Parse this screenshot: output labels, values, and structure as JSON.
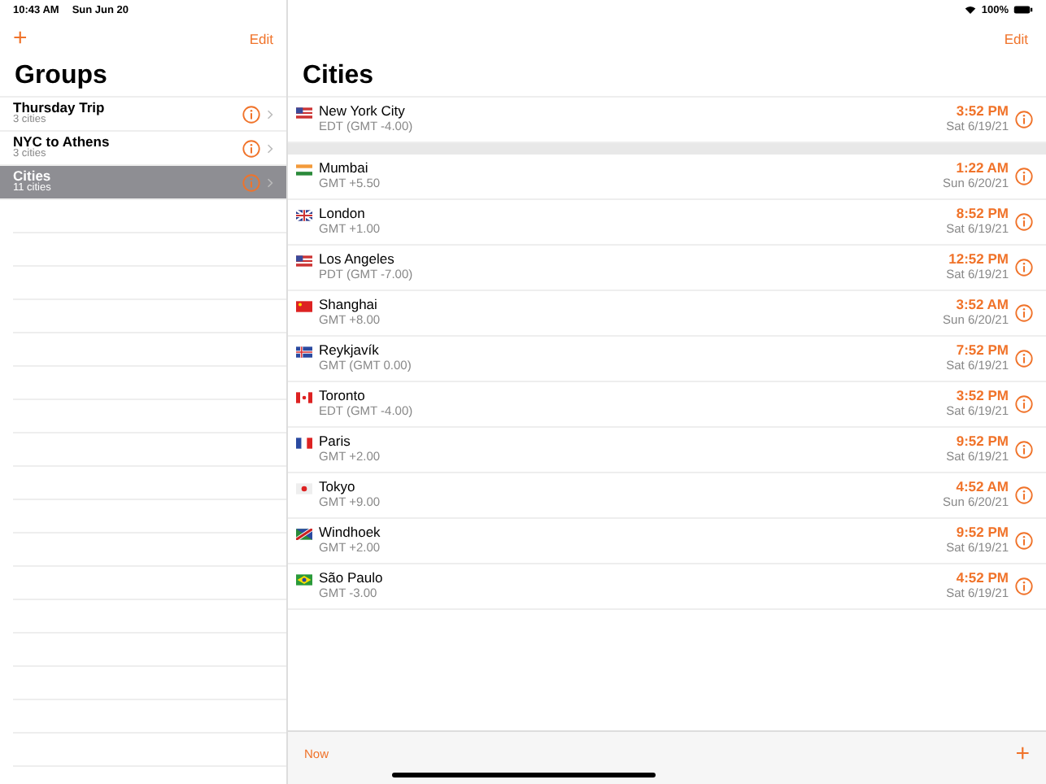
{
  "status_bar": {
    "time": "10:43 AM",
    "date": "Sun Jun 20",
    "battery": "100%"
  },
  "groups_pane": {
    "add": "+",
    "edit": "Edit",
    "title": "Groups",
    "items": [
      {
        "name": "Thursday Trip",
        "count": "3 cities",
        "selected": false
      },
      {
        "name": "NYC to Athens",
        "count": "3 cities",
        "selected": false
      },
      {
        "name": "Cities",
        "count": "11 cities",
        "selected": true
      }
    ]
  },
  "cities_pane": {
    "edit": "Edit",
    "title": "Cities",
    "home": {
      "kind": "us",
      "name": "New York City",
      "zone": "EDT (GMT -4.00)",
      "time": "3:52 PM",
      "date": "Sat 6/19/21"
    },
    "cities": [
      {
        "kind": "in",
        "name": "Mumbai",
        "zone": "GMT +5.50",
        "time": "1:22 AM",
        "date": "Sun 6/20/21"
      },
      {
        "kind": "gb",
        "name": "London",
        "zone": "GMT +1.00",
        "time": "8:52 PM",
        "date": "Sat 6/19/21"
      },
      {
        "kind": "us",
        "name": "Los Angeles",
        "zone": "PDT (GMT -7.00)",
        "time": "12:52 PM",
        "date": "Sat 6/19/21"
      },
      {
        "kind": "cn",
        "name": "Shanghai",
        "zone": "GMT +8.00",
        "time": "3:52 AM",
        "date": "Sun 6/20/21"
      },
      {
        "kind": "is",
        "name": "Reykjavík",
        "zone": "GMT (GMT 0.00)",
        "time": "7:52 PM",
        "date": "Sat 6/19/21"
      },
      {
        "kind": "ca",
        "name": "Toronto",
        "zone": "EDT (GMT -4.00)",
        "time": "3:52 PM",
        "date": "Sat 6/19/21"
      },
      {
        "kind": "fr",
        "name": "Paris",
        "zone": "GMT +2.00",
        "time": "9:52 PM",
        "date": "Sat 6/19/21"
      },
      {
        "kind": "jp",
        "name": "Tokyo",
        "zone": "GMT +9.00",
        "time": "4:52 AM",
        "date": "Sun 6/20/21"
      },
      {
        "kind": "na",
        "name": "Windhoek",
        "zone": "GMT +2.00",
        "time": "9:52 PM",
        "date": "Sat 6/19/21"
      },
      {
        "kind": "br",
        "name": "São Paulo",
        "zone": "GMT -3.00",
        "time": "4:52 PM",
        "date": "Sat 6/19/21"
      }
    ],
    "toolbar": {
      "now": "Now",
      "add": "+"
    }
  }
}
